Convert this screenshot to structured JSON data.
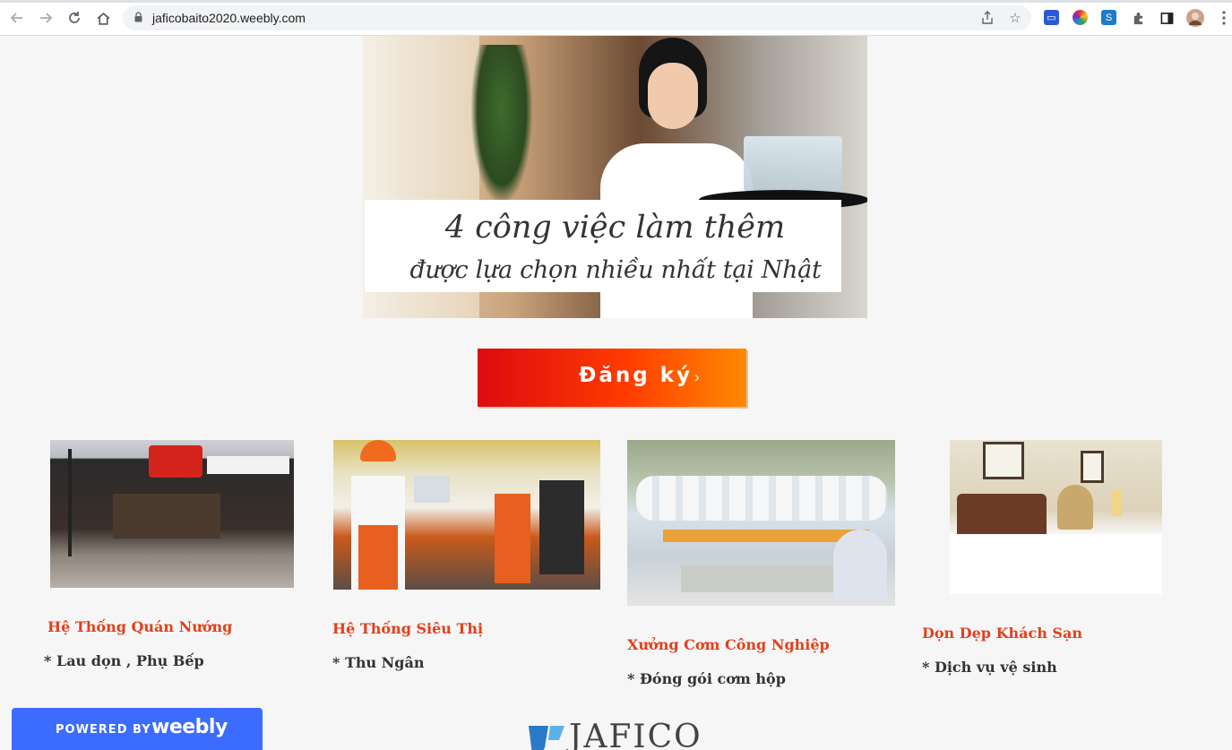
{
  "browser": {
    "url": "jaficobaito2020.weebly.com",
    "icons": [
      "back-icon",
      "forward-icon",
      "reload-icon",
      "home-icon",
      "lock-icon",
      "share-icon",
      "star-icon",
      "extension-icon",
      "puzzle-icon",
      "sidebar-icon",
      "profile-avatar",
      "menu-icon"
    ]
  },
  "hero": {
    "line1": "4 công việc làm thêm",
    "line2": "được lựa chọn nhiều nhất tại Nhật"
  },
  "cta": {
    "label": "Đăng ký",
    "chevron": "›"
  },
  "jobs": [
    {
      "title": "Hệ Thống Quán Nướng",
      "desc": "* Lau dọn , Phụ Bếp"
    },
    {
      "title": "Hệ Thống Siêu Thị",
      "desc": "* Thu Ngân"
    },
    {
      "title": "Xưởng Cơm Công Nghiệp",
      "desc": "* Đóng gói cơm hộp"
    },
    {
      "title": "Dọn Dẹp Khách Sạn",
      "desc": "* Dịch vụ vệ sinh"
    }
  ],
  "footer": {
    "powered_by": "POWERED BY",
    "weebly": "weebly",
    "logo_text": "JAFICO"
  },
  "colors": {
    "accent": "#e3401b",
    "weebly_blue": "#3b6cff",
    "cta_start": "#dd0a10",
    "cta_end": "#ff8a00"
  }
}
